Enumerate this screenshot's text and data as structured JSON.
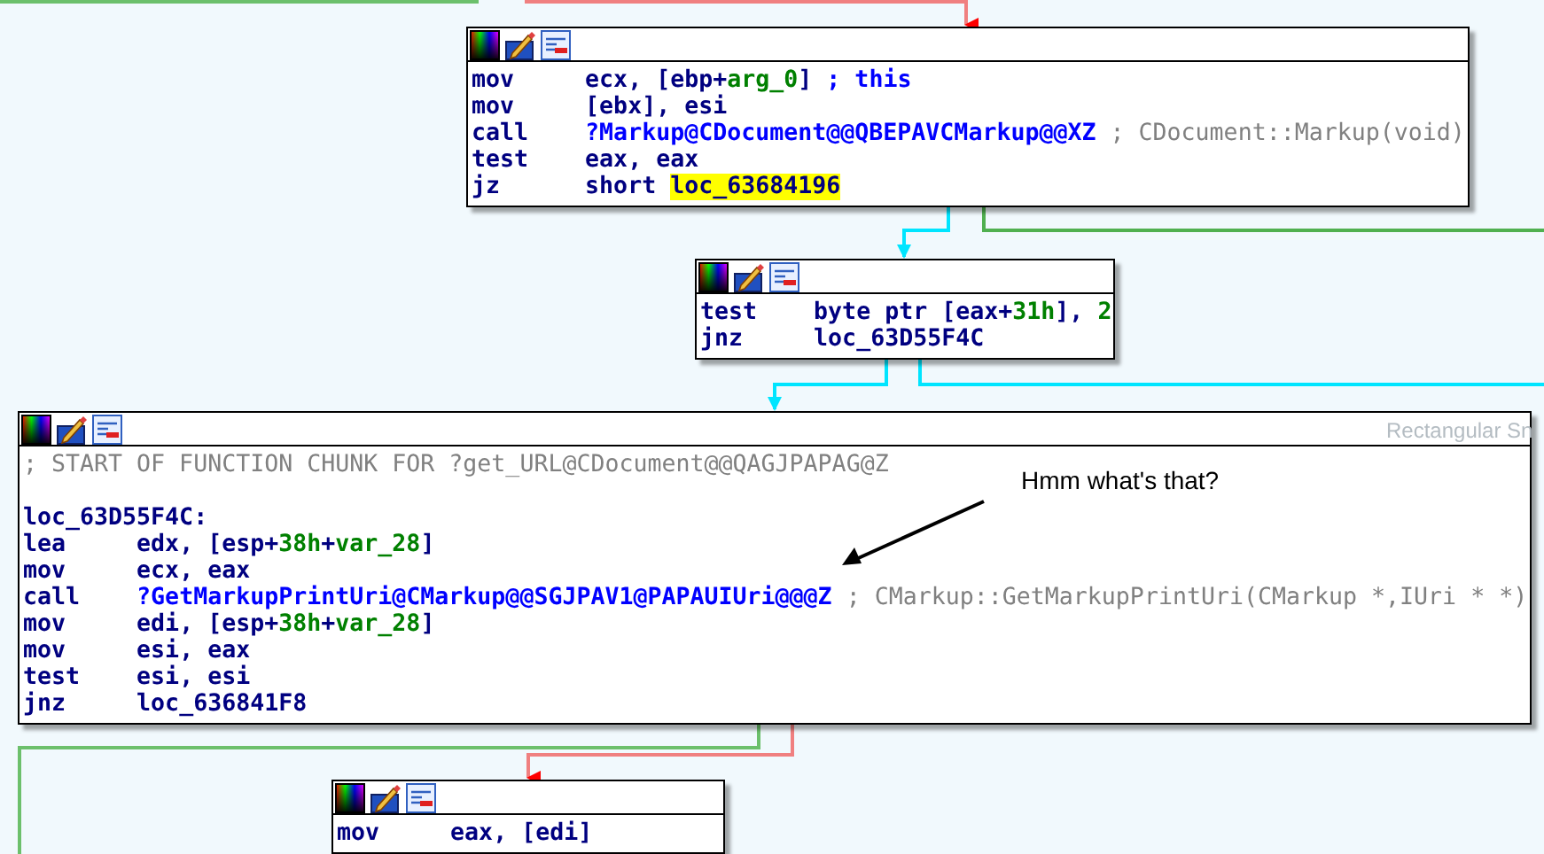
{
  "blocks": [
    {
      "lines": [
        {
          "kind": "instruction",
          "mnemonic": "mov",
          "operands": [
            {
              "text": "ecx, [ebp+",
              "kind": "plain"
            },
            {
              "text": "arg_0",
              "kind": "var"
            },
            {
              "text": "]",
              "kind": "plain"
            }
          ],
          "comment": {
            "text": "; this",
            "kind": "user"
          }
        },
        {
          "kind": "instruction",
          "mnemonic": "mov",
          "operands": [
            {
              "text": "[ebx], esi",
              "kind": "plain"
            }
          ]
        },
        {
          "kind": "instruction",
          "mnemonic": "call",
          "operands": [
            {
              "text": "?Markup@CDocument@@QBEPAVCMarkup@@XZ",
              "kind": "symbol"
            }
          ],
          "comment": {
            "text": "; CDocument::Markup(void)",
            "kind": "auto"
          }
        },
        {
          "kind": "instruction",
          "mnemonic": "test",
          "operands": [
            {
              "text": "eax, eax",
              "kind": "plain"
            }
          ]
        },
        {
          "kind": "instruction",
          "mnemonic": "jz",
          "operands": [
            {
              "text": "short ",
              "kind": "plain"
            },
            {
              "text": "loc_63684196",
              "kind": "highlight"
            }
          ]
        }
      ]
    },
    {
      "lines": [
        {
          "kind": "instruction",
          "mnemonic": "test",
          "operands": [
            {
              "text": "byte ptr [eax+",
              "kind": "plain"
            },
            {
              "text": "31h",
              "kind": "number"
            },
            {
              "text": "], ",
              "kind": "plain"
            },
            {
              "text": "2",
              "kind": "number"
            }
          ]
        },
        {
          "kind": "instruction",
          "mnemonic": "jnz",
          "operands": [
            {
              "text": "loc_63D55F4C",
              "kind": "plain"
            }
          ]
        }
      ]
    },
    {
      "lines": [
        {
          "kind": "comment",
          "text": "; START OF FUNCTION CHUNK FOR ?get_URL@CDocument@@QAGJPAPAG@Z"
        },
        {
          "kind": "blank"
        },
        {
          "kind": "label",
          "text": "loc_63D55F4C:"
        },
        {
          "kind": "instruction",
          "mnemonic": "lea",
          "operands": [
            {
              "text": "edx, [esp+",
              "kind": "plain"
            },
            {
              "text": "38h",
              "kind": "number"
            },
            {
              "text": "+",
              "kind": "plain"
            },
            {
              "text": "var_28",
              "kind": "var"
            },
            {
              "text": "]",
              "kind": "plain"
            }
          ]
        },
        {
          "kind": "instruction",
          "mnemonic": "mov",
          "operands": [
            {
              "text": "ecx, eax",
              "kind": "plain"
            }
          ]
        },
        {
          "kind": "instruction",
          "mnemonic": "call",
          "operands": [
            {
              "text": "?GetMarkupPrintUri@CMarkup@@SGJPAV1@PAPAUIUri@@@Z",
              "kind": "symbol"
            }
          ],
          "comment": {
            "text": "; CMarkup::GetMarkupPrintUri(CMarkup *,IUri * *)",
            "kind": "auto"
          }
        },
        {
          "kind": "instruction",
          "mnemonic": "mov",
          "operands": [
            {
              "text": "edi, [esp+",
              "kind": "plain"
            },
            {
              "text": "38h",
              "kind": "number"
            },
            {
              "text": "+",
              "kind": "plain"
            },
            {
              "text": "var_28",
              "kind": "var"
            },
            {
              "text": "]",
              "kind": "plain"
            }
          ]
        },
        {
          "kind": "instruction",
          "mnemonic": "mov",
          "operands": [
            {
              "text": "esi, eax",
              "kind": "plain"
            }
          ]
        },
        {
          "kind": "instruction",
          "mnemonic": "test",
          "operands": [
            {
              "text": "esi, esi",
              "kind": "plain"
            }
          ]
        },
        {
          "kind": "instruction",
          "mnemonic": "jnz",
          "operands": [
            {
              "text": "loc_636841F8",
              "kind": "plain"
            }
          ]
        }
      ]
    },
    {
      "lines": [
        {
          "kind": "instruction",
          "mnemonic": "mov",
          "operands": [
            {
              "text": "eax, [edi]",
              "kind": "plain"
            }
          ]
        }
      ]
    }
  ],
  "annotation": {
    "text": "Hmm what's that?"
  },
  "overlay_hint": "Rectangular Sn"
}
